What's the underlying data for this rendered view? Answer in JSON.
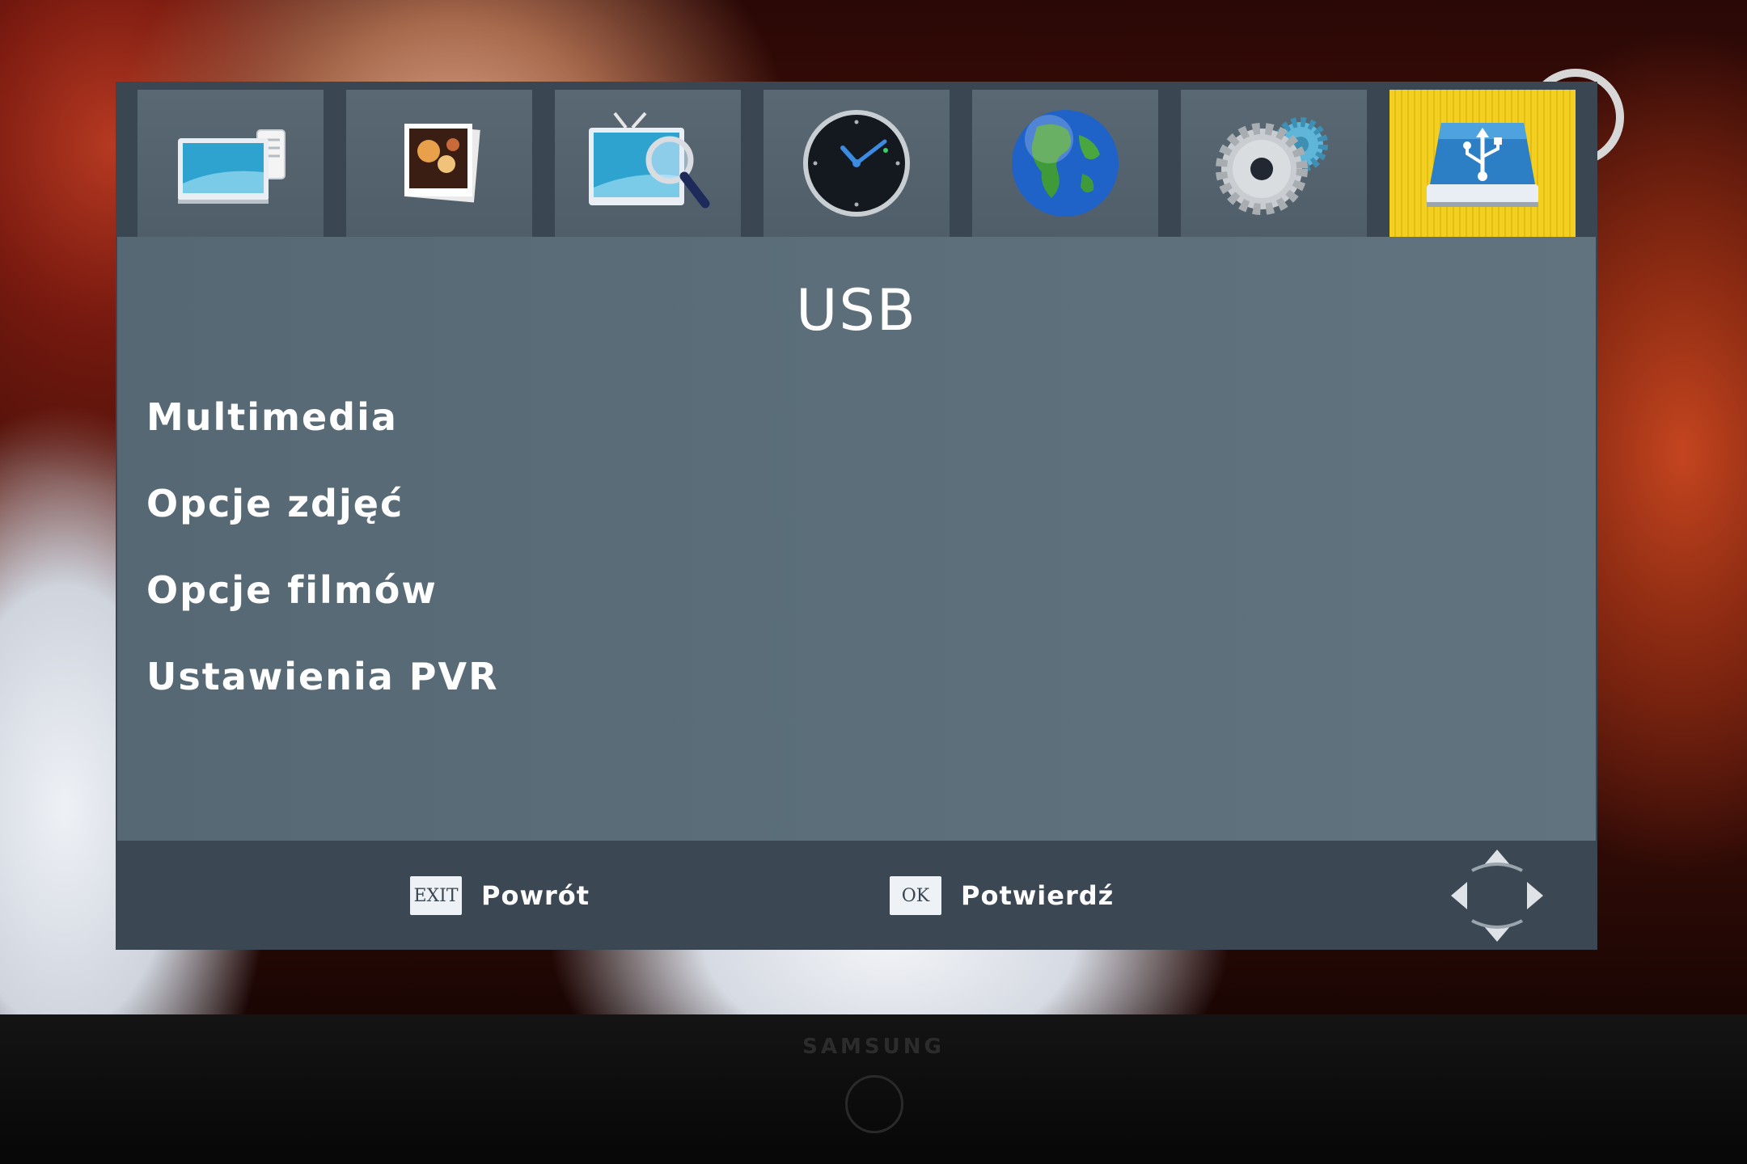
{
  "osd": {
    "tabs": [
      {
        "icon": "tv-list-icon",
        "active": false
      },
      {
        "icon": "photos-icon",
        "active": false
      },
      {
        "icon": "tv-search-icon",
        "active": false
      },
      {
        "icon": "clock-icon",
        "active": false
      },
      {
        "icon": "globe-icon",
        "active": false
      },
      {
        "icon": "gears-icon",
        "active": false
      },
      {
        "icon": "usb-drive-icon",
        "active": true
      }
    ],
    "title": "USB",
    "menu_items": [
      {
        "label": "Multimedia"
      },
      {
        "label": "Opcje zdjęć"
      },
      {
        "label": "Opcje filmów"
      },
      {
        "label": "Ustawienia PVR"
      }
    ],
    "footer": {
      "back": {
        "key": "EXIT",
        "label": "Powrót"
      },
      "confirm": {
        "key": "OK",
        "label": "Potwierdź"
      }
    }
  },
  "tv": {
    "brand": "SAMSUNG"
  },
  "colors": {
    "panel": "#5b6e7a",
    "bar": "#3a4651",
    "active_tab": "#f3cf22",
    "text": "#ffffff"
  }
}
